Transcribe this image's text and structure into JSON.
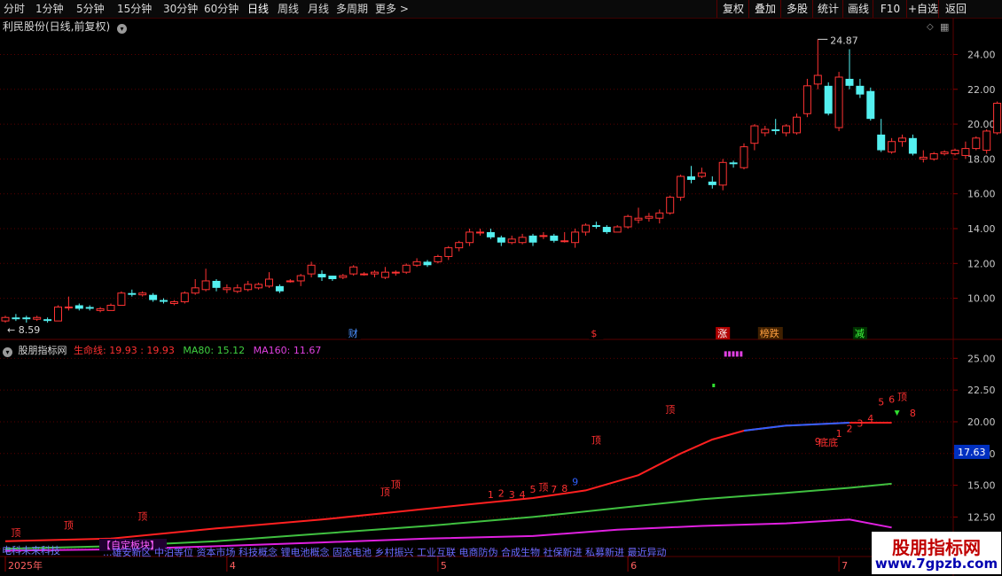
{
  "toolbar": {
    "left_items": [
      "分时",
      "1分钟",
      "5分钟",
      "15分钟",
      "30分钟",
      "60分钟",
      "日线",
      "周线",
      "月线",
      "多周期",
      "更多 >"
    ],
    "active": "日线",
    "right_items": [
      "复权",
      "叠加",
      "多股",
      "统计",
      "画线",
      "F10",
      "+自选",
      "返回"
    ]
  },
  "main_title": "利民股份(日线,前复权)",
  "indicator_title": {
    "name": "股朋指标网",
    "parts": [
      {
        "label": "生命线: 19.93 : 19.93",
        "color": "#ff3030"
      },
      {
        "label": "MA80: 15.12",
        "color": "#40d040"
      },
      {
        "label": "MA160: 11.67",
        "color": "#e040e0"
      }
    ]
  },
  "watermark": {
    "line1": "股朋指标网",
    "line2": "www.7gpzb.com"
  },
  "colors": {
    "up": "#ff3333",
    "down": "#54f0f0",
    "life": "#ff2020",
    "life_blue": "#3060ff",
    "ma80": "#40c040",
    "ma160": "#e020e0",
    "grid": "#5a0000"
  },
  "chart_data": [
    {
      "type": "candlestick",
      "ylim": [
        8.2,
        25.6
      ],
      "yticks": [
        "10.00",
        "12.00",
        "14.00",
        "16.00",
        "18.00",
        "20.00",
        "22.00",
        "24.00"
      ],
      "high_label": "24.87",
      "low_label": "8.59",
      "candles": [
        [
          8.7,
          8.9,
          8.6,
          9.0
        ],
        [
          8.9,
          8.8,
          8.7,
          9.1
        ],
        [
          8.9,
          8.8,
          8.6,
          9.0
        ],
        [
          8.8,
          8.9,
          8.7,
          9.0
        ],
        [
          8.8,
          8.7,
          8.6,
          8.9
        ],
        [
          8.7,
          9.5,
          8.7,
          9.6
        ],
        [
          9.5,
          9.5,
          9.3,
          10.1
        ],
        [
          9.6,
          9.4,
          9.3,
          9.7
        ],
        [
          9.5,
          9.4,
          9.3,
          9.6
        ],
        [
          9.3,
          9.4,
          9.2,
          9.5
        ],
        [
          9.3,
          9.6,
          9.3,
          9.7
        ],
        [
          9.6,
          10.3,
          9.6,
          10.4
        ],
        [
          10.3,
          10.2,
          10.1,
          10.5
        ],
        [
          10.2,
          10.3,
          10.1,
          10.4
        ],
        [
          10.2,
          9.9,
          9.8,
          10.3
        ],
        [
          9.9,
          9.8,
          9.7,
          10.0
        ],
        [
          9.7,
          9.8,
          9.6,
          9.9
        ],
        [
          9.8,
          10.3,
          9.7,
          10.4
        ],
        [
          10.3,
          10.6,
          10.2,
          11.1
        ],
        [
          10.5,
          11.0,
          10.4,
          11.7
        ],
        [
          11.0,
          10.6,
          10.4,
          11.1
        ],
        [
          10.5,
          10.6,
          10.3,
          10.8
        ],
        [
          10.4,
          10.6,
          10.3,
          10.8
        ],
        [
          10.5,
          10.8,
          10.4,
          11.0
        ],
        [
          10.6,
          10.8,
          10.5,
          10.9
        ],
        [
          10.7,
          11.1,
          10.6,
          11.5
        ],
        [
          10.7,
          10.4,
          10.3,
          10.8
        ],
        [
          11.0,
          11.0,
          10.9,
          11.1
        ],
        [
          11.0,
          11.3,
          10.7,
          11.4
        ],
        [
          11.4,
          11.9,
          11.2,
          12.1
        ],
        [
          11.4,
          11.2,
          11.0,
          11.6
        ],
        [
          11.3,
          11.1,
          11.0,
          11.3
        ],
        [
          11.2,
          11.3,
          11.1,
          11.4
        ],
        [
          11.4,
          11.8,
          11.3,
          11.9
        ],
        [
          11.4,
          11.4,
          11.3,
          11.5
        ],
        [
          11.4,
          11.5,
          11.2,
          11.6
        ],
        [
          11.2,
          11.5,
          11.1,
          11.8
        ],
        [
          11.5,
          11.5,
          11.3,
          11.6
        ],
        [
          11.5,
          11.9,
          11.4,
          12.0
        ],
        [
          11.9,
          12.1,
          11.8,
          12.3
        ],
        [
          12.1,
          11.9,
          11.8,
          12.2
        ],
        [
          12.1,
          12.4,
          12.0,
          12.5
        ],
        [
          12.4,
          12.9,
          12.2,
          13.0
        ],
        [
          12.9,
          13.2,
          12.7,
          13.3
        ],
        [
          13.2,
          13.8,
          13.0,
          14.0
        ],
        [
          13.8,
          13.8,
          13.6,
          14.0
        ],
        [
          13.8,
          13.5,
          13.4,
          14.0
        ],
        [
          13.5,
          13.2,
          13.0,
          13.6
        ],
        [
          13.2,
          13.4,
          13.1,
          13.6
        ],
        [
          13.2,
          13.5,
          13.1,
          13.7
        ],
        [
          13.6,
          13.2,
          13.0,
          13.7
        ],
        [
          13.6,
          13.6,
          13.4,
          13.8
        ],
        [
          13.6,
          13.3,
          13.2,
          13.7
        ],
        [
          13.3,
          13.3,
          13.2,
          13.8
        ],
        [
          13.2,
          13.8,
          12.9,
          14.0
        ],
        [
          13.8,
          14.2,
          13.6,
          14.3
        ],
        [
          14.2,
          14.1,
          14.0,
          14.4
        ],
        [
          14.1,
          13.8,
          13.7,
          14.2
        ],
        [
          13.8,
          14.1,
          13.8,
          14.2
        ],
        [
          14.1,
          14.7,
          14.0,
          14.8
        ],
        [
          14.5,
          14.6,
          14.3,
          15.2
        ],
        [
          14.6,
          14.7,
          14.4,
          14.9
        ],
        [
          14.6,
          14.9,
          14.3,
          15.1
        ],
        [
          14.9,
          15.8,
          14.8,
          15.9
        ],
        [
          15.8,
          17.0,
          15.6,
          17.1
        ],
        [
          17.0,
          16.8,
          16.6,
          17.6
        ],
        [
          17.0,
          17.2,
          16.9,
          17.5
        ],
        [
          16.7,
          16.5,
          16.3,
          17.0
        ],
        [
          16.5,
          17.8,
          16.2,
          18.0
        ],
        [
          17.8,
          17.7,
          17.5,
          17.9
        ],
        [
          17.5,
          18.7,
          17.4,
          18.9
        ],
        [
          18.9,
          19.9,
          18.5,
          20.0
        ],
        [
          19.5,
          19.7,
          19.3,
          19.9
        ],
        [
          19.7,
          19.6,
          19.4,
          20.3
        ],
        [
          19.5,
          19.9,
          19.3,
          20.0
        ],
        [
          19.5,
          20.4,
          19.4,
          20.6
        ],
        [
          20.6,
          22.2,
          20.4,
          22.6
        ],
        [
          22.3,
          22.8,
          22.0,
          24.87
        ],
        [
          22.2,
          20.6,
          20.5,
          22.4
        ],
        [
          19.8,
          22.7,
          19.6,
          23.0
        ],
        [
          22.6,
          22.2,
          22.0,
          24.3
        ],
        [
          22.2,
          21.7,
          21.5,
          22.6
        ],
        [
          21.9,
          20.3,
          20.2,
          22.1
        ],
        [
          19.4,
          18.5,
          18.4,
          20.3
        ],
        [
          18.4,
          19.0,
          18.3,
          19.2
        ],
        [
          19.0,
          19.2,
          18.7,
          19.4
        ],
        [
          19.2,
          18.3,
          18.2,
          19.4
        ],
        [
          18.0,
          18.1,
          17.8,
          18.5
        ],
        [
          18.0,
          18.3,
          17.9,
          18.4
        ],
        [
          18.3,
          18.4,
          18.2,
          18.5
        ],
        [
          18.3,
          18.5,
          18.2,
          18.6
        ],
        [
          18.2,
          18.6,
          18.0,
          19.0
        ],
        [
          18.6,
          19.2,
          18.5,
          19.3
        ],
        [
          18.5,
          19.6,
          18.3,
          19.7
        ],
        [
          19.5,
          21.2,
          19.4,
          21.3
        ],
        [
          20.9,
          20.9,
          20.7,
          21.1
        ],
        [
          20.7,
          20.5,
          20.4,
          21.9
        ],
        [
          20.3,
          20.2,
          19.6,
          20.6
        ]
      ],
      "event_markers": [
        {
          "label": "财",
          "color": "#4a90ff",
          "bg": "#000",
          "index": 33
        },
        {
          "label": "$",
          "color": "#ff3030",
          "bg": "#000",
          "index": 56
        },
        {
          "label": "涨",
          "color": "#ffffff",
          "bg": "#b00000",
          "index": 68
        },
        {
          "label": "榜跌",
          "color": "#ffa040",
          "bg": "#402000",
          "index": 72
        },
        {
          "label": "减",
          "color": "#40ff40",
          "bg": "#003000",
          "index": 81
        }
      ]
    },
    {
      "type": "line",
      "ylim": [
        9.6,
        26.0
      ],
      "yticks": [
        "10.00",
        "12.50",
        "15.00",
        "17.50",
        "20.00",
        "22.50",
        "25.00"
      ],
      "current_label": "17.63",
      "x_labels": [
        {
          "text": "2025年",
          "index": 0
        },
        {
          "text": "4",
          "index": 21
        },
        {
          "text": "5",
          "index": 41
        },
        {
          "text": "6",
          "index": 59
        },
        {
          "text": "7",
          "index": 79
        }
      ],
      "series": [
        {
          "name": "生命线",
          "color": "#ff2020",
          "points": [
            [
              0,
              10.6
            ],
            [
              10,
              10.8
            ],
            [
              20,
              11.6
            ],
            [
              30,
              12.3
            ],
            [
              37,
              12.9
            ],
            [
              44,
              13.5
            ],
            [
              50,
              14.0
            ],
            [
              55,
              14.6
            ],
            [
              60,
              15.8
            ],
            [
              64,
              17.5
            ],
            [
              67,
              18.6
            ],
            [
              70,
              19.3
            ],
            [
              74,
              19.7
            ],
            [
              80,
              19.93
            ],
            [
              84,
              19.93
            ]
          ]
        },
        {
          "name": "MA80",
          "color": "#40c040",
          "points": [
            [
              0,
              10.0
            ],
            [
              10,
              10.2
            ],
            [
              20,
              10.6
            ],
            [
              30,
              11.2
            ],
            [
              40,
              11.8
            ],
            [
              50,
              12.5
            ],
            [
              58,
              13.2
            ],
            [
              66,
              13.9
            ],
            [
              74,
              14.4
            ],
            [
              80,
              14.8
            ],
            [
              84,
              15.12
            ]
          ]
        },
        {
          "name": "MA160",
          "color": "#e020e0",
          "points": [
            [
              0,
              9.85
            ],
            [
              10,
              9.95
            ],
            [
              20,
              10.2
            ],
            [
              30,
              10.5
            ],
            [
              40,
              10.8
            ],
            [
              50,
              11.0
            ],
            [
              58,
              11.5
            ],
            [
              66,
              11.8
            ],
            [
              74,
              12.0
            ],
            [
              80,
              12.3
            ],
            [
              84,
              11.67
            ]
          ]
        }
      ],
      "annotations": [
        {
          "text": "顶",
          "color": "#ff3030",
          "index": 1,
          "value": 11.0
        },
        {
          "text": "顶",
          "color": "#ff3030",
          "index": 6,
          "value": 11.6
        },
        {
          "text": "顶",
          "color": "#ff3030",
          "index": 13,
          "value": 12.3
        },
        {
          "text": "顶",
          "color": "#ff3030",
          "index": 36,
          "value": 14.2
        },
        {
          "text": "顶",
          "color": "#ff3030",
          "index": 37,
          "value": 14.8
        },
        {
          "text": "1",
          "color": "#ff3030",
          "index": 46,
          "value": 14.0
        },
        {
          "text": "2",
          "color": "#ff3030",
          "index": 47,
          "value": 14.1
        },
        {
          "text": "3",
          "color": "#ff3030",
          "index": 48,
          "value": 14.0
        },
        {
          "text": "4",
          "color": "#ff3030",
          "index": 49,
          "value": 14.0
        },
        {
          "text": "5",
          "color": "#ff3030",
          "index": 50,
          "value": 14.4
        },
        {
          "text": "顶",
          "color": "#ff3030",
          "index": 51,
          "value": 14.6
        },
        {
          "text": "7",
          "color": "#ff3030",
          "index": 52,
          "value": 14.4
        },
        {
          "text": "8",
          "color": "#ff3030",
          "index": 53,
          "value": 14.5
        },
        {
          "text": "9",
          "color": "#3060ff",
          "index": 54,
          "value": 15.0
        },
        {
          "text": "顶",
          "color": "#ff3030",
          "index": 56,
          "value": 18.3
        },
        {
          "text": "顶",
          "color": "#ff3030",
          "index": 63,
          "value": 20.7
        },
        {
          "text": "1",
          "color": "#ff3030",
          "index": 79,
          "value": 18.8
        },
        {
          "text": "2",
          "color": "#ff3030",
          "index": 80,
          "value": 19.2
        },
        {
          "text": "3",
          "color": "#ff3030",
          "index": 81,
          "value": 19.6
        },
        {
          "text": "4",
          "color": "#ff3030",
          "index": 82,
          "value": 20.0
        },
        {
          "text": "9",
          "color": "#ff3030",
          "index": 77,
          "value": 18.2
        },
        {
          "text": "底底",
          "color": "#ff3030",
          "index": 78,
          "value": 18.1
        },
        {
          "text": "5",
          "color": "#ff3030",
          "index": 83,
          "value": 21.3
        },
        {
          "text": "6",
          "color": "#ff3030",
          "index": 84,
          "value": 21.5
        },
        {
          "text": "顶",
          "color": "#ff3030",
          "index": 85,
          "value": 21.7
        },
        {
          "text": "8",
          "color": "#ff3030",
          "index": 86,
          "value": 20.4
        }
      ]
    }
  ],
  "bottom_bar": {
    "left_text": "电科未来科技",
    "box_text": "【自定板块】",
    "tags": "...雄安新区 中泊等位 资本市场 科技概念 锂电池概念 固态电池 乡村振兴 工业互联 电商防伪 合成生物 社保新进 私募新进 最近异动"
  }
}
